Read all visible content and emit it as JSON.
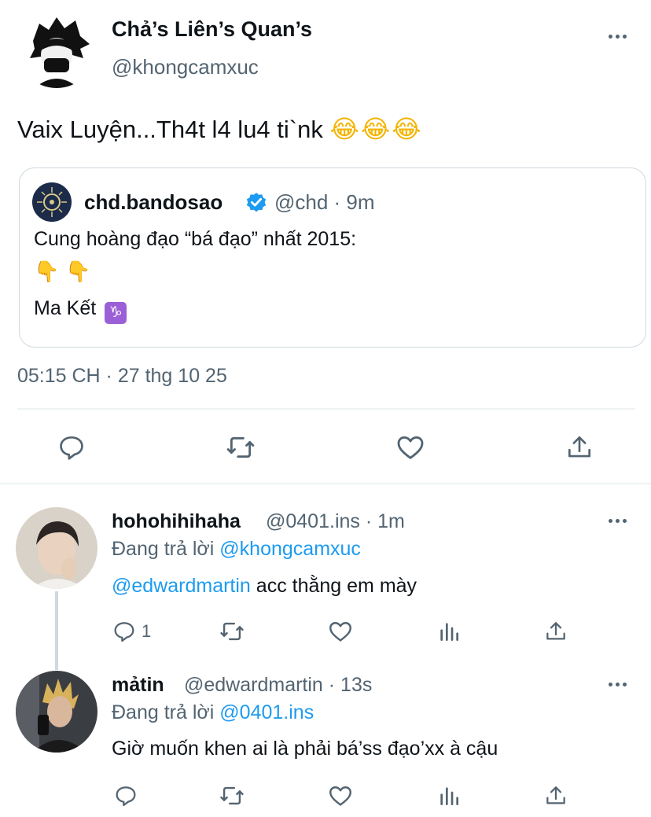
{
  "main_tweet": {
    "display_name": "Chả’s Liên’s Quan’s",
    "handle": "@khongcamxuc",
    "text": "Vaix Luyện...Th4t l4 lu4 ti`nk",
    "emoji": "😂😂😂",
    "timestamp": "05:15 CH · 27 thg 10 25",
    "quote": {
      "display_name": "chd.bandosao",
      "verified": true,
      "meta": "@chd · 9m",
      "line1": "Cung hoàng đạo “bá đạo” nhất 2015:",
      "pointers": "👇👇",
      "line3": "Ma Kết",
      "zodiac_symbol": "♑"
    },
    "actions": [
      "reply-icon",
      "retweet-icon",
      "like-icon",
      "share-icon"
    ]
  },
  "replies": [
    {
      "display_name": "hohohihihaha",
      "meta": "@0401.ins · 1m",
      "replying_prefix": "Đang trả lời",
      "replying_to": "@khongcamxuc",
      "mention": "@edwardmartin",
      "text": " acc thằng em mày",
      "reply_count": "1"
    },
    {
      "display_name": "mảtin",
      "meta": "@edwardmartin · 13s",
      "replying_prefix": "Đang trả lời",
      "replying_to": "@0401.ins",
      "text": "Giờ muốn khen ai là phải bá’ss đạo’xx à cậu"
    }
  ],
  "colors": {
    "link": "#1d9bf0",
    "secondary_text": "#536471",
    "verified": "#1d9bf0",
    "divider": "#eff3f4"
  }
}
